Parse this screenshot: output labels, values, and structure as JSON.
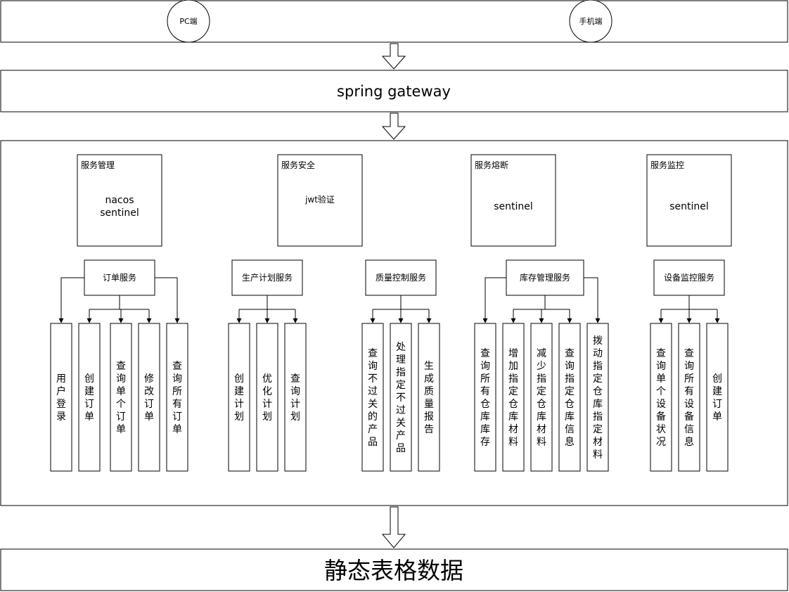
{
  "clients": {
    "pc": "PC端",
    "mobile": "手机端"
  },
  "gateway": {
    "label": "spring gateway"
  },
  "infra": [
    {
      "title": "服务管理",
      "lines": [
        "nacos",
        "sentinel"
      ]
    },
    {
      "title": "服务安全",
      "lines": [
        "jwt验证"
      ]
    },
    {
      "title": "服务熔断",
      "lines": [
        "sentinel"
      ]
    },
    {
      "title": "服务监控",
      "lines": [
        "sentinel"
      ]
    }
  ],
  "services": [
    {
      "name": "订单服务",
      "children": [
        "用户登录",
        "创建订单",
        "查询单个订单",
        "修改订单",
        "查询所有订单"
      ]
    },
    {
      "name": "生产计划服务",
      "children": [
        "创建计划",
        "优化计划",
        "查询计划"
      ]
    },
    {
      "name": "质量控制服务",
      "children": [
        "查询不过关的产品",
        "处理指定不过关产品",
        "生成质量报告"
      ]
    },
    {
      "name": "库存管理服务",
      "children": [
        "查询所有仓库库存",
        "增加指定仓库材料",
        "减少指定仓库材料",
        "查询指定仓库信息",
        "拨动指定仓库指定材料"
      ]
    },
    {
      "name": "设备监控服务",
      "children": [
        "查询单个设备状况",
        "查询所有设备信息",
        "创建订单"
      ]
    }
  ],
  "datastore": {
    "label": "静态表格数据"
  }
}
